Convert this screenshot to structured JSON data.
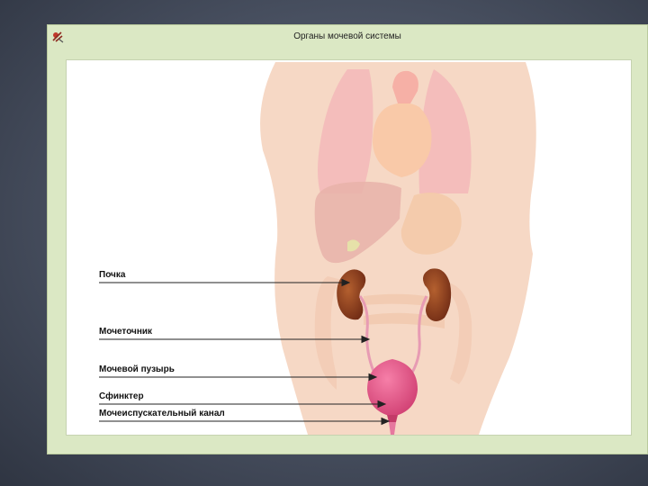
{
  "window": {
    "title": "Органы мочевой системы",
    "icon": "app-emblem-icon"
  },
  "labels": {
    "kidney": "Почка",
    "ureter": "Мочеточник",
    "bladder": "Мочевой пузырь",
    "sphincter": "Сфинктер",
    "urethra": "Мочеиспускательный канал"
  },
  "colors": {
    "kidney": "#8e3c1f",
    "bladder": "#e24f84",
    "ureter": "#e79bb3",
    "body": "#f6d8c5",
    "frame": "#dbe8c4"
  }
}
